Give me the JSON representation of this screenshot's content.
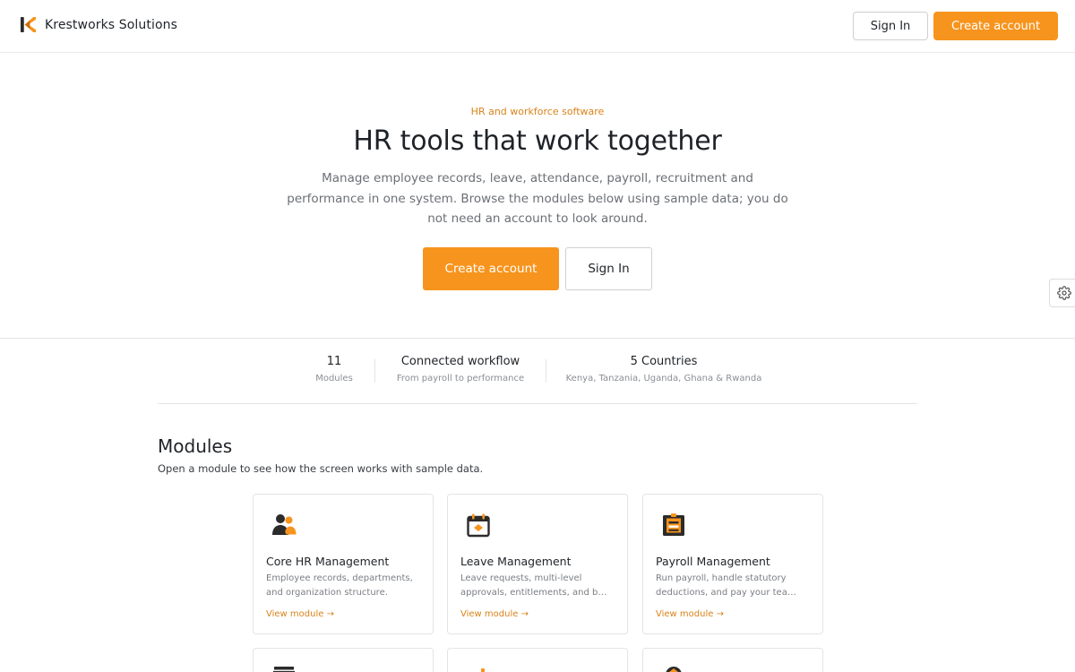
{
  "colors": {
    "accent": "#f7941d",
    "accent_text": "#d9831a",
    "text": "#1f2328",
    "muted": "#6b6f75",
    "border": "#e4e4e4"
  },
  "header": {
    "brand_name": "Krestworks Solutions",
    "logo_icon": "krestworks-logo-icon",
    "sign_in_label": "Sign In",
    "create_account_label": "Create account"
  },
  "hero": {
    "eyebrow": "HR and workforce software",
    "title": "HR tools that work together",
    "description": "Manage employee records, leave, attendance, payroll, recruitment and performance in one system. Browse the modules below using sample data; you do not need an account to look around.",
    "create_account_label": "Create account",
    "sign_in_label": "Sign In"
  },
  "side_widget": {
    "icon": "gear-icon"
  },
  "stats": [
    {
      "value": "11",
      "label": "Modules"
    },
    {
      "value": "Connected workflow",
      "label": "From payroll to performance"
    },
    {
      "value": "5 Countries",
      "label": "Kenya, Tanzania, Uganda, Ghana & Rwanda"
    }
  ],
  "modules": {
    "title": "Modules",
    "subtitle": "Open a module to see how the screen works with sample data.",
    "cards": [
      {
        "icon": "people-icon",
        "title": "Core HR Management",
        "description": "Employee records, departments, and organization structure.",
        "link": "View module →"
      },
      {
        "icon": "calendar-icon",
        "title": "Leave Management",
        "description": "Leave requests, multi-level approvals, entitlements, and b…",
        "link": "View module →"
      },
      {
        "icon": "payroll-icon",
        "title": "Payroll Management",
        "description": "Run payroll, handle statutory deductions, and pay your tea…",
        "link": "View module →"
      }
    ],
    "next_row_icons": [
      "document-icon",
      "user-badge-icon",
      "performance-icon"
    ]
  }
}
